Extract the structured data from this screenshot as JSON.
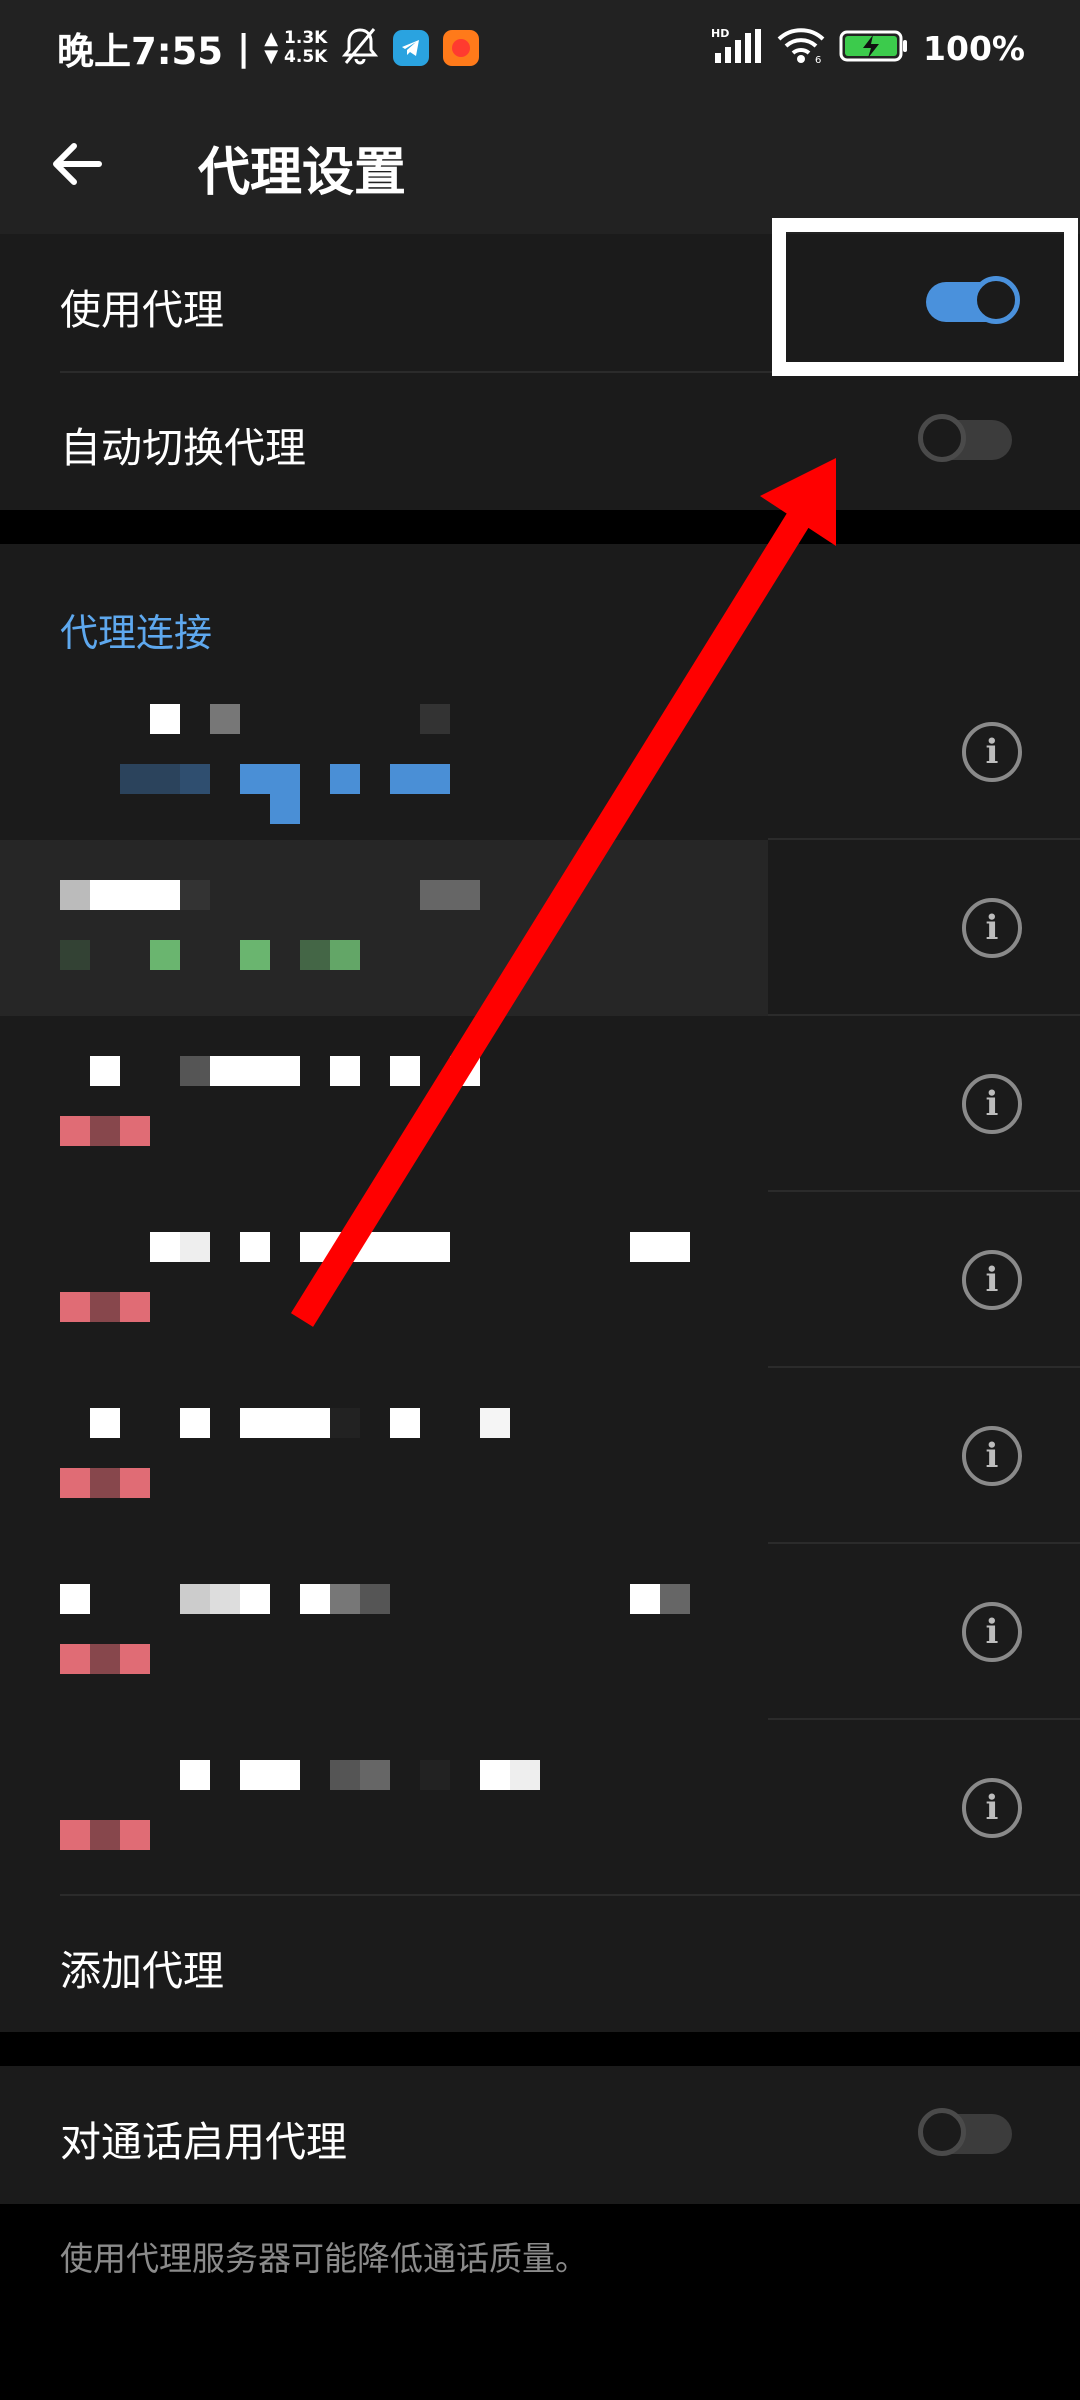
{
  "status_bar": {
    "time": "晚上7:55",
    "separator": "|",
    "speed_up": "1.3K",
    "speed_down": "4.5K",
    "network_label": "HD",
    "battery": "100%"
  },
  "toolbar": {
    "title": "代理设置"
  },
  "settings": {
    "use_proxy": {
      "label": "使用代理",
      "enabled": true
    },
    "auto_switch": {
      "label": "自动切换代理",
      "enabled": false
    }
  },
  "connections": {
    "header": "代理连接",
    "items": [
      {
        "status_color": "#4a8fd6",
        "selected": false
      },
      {
        "status_color": "#6ab56f",
        "selected": true
      },
      {
        "status_color": "#e06c75",
        "selected": false
      },
      {
        "status_color": "#e06c75",
        "selected": false
      },
      {
        "status_color": "#e06c75",
        "selected": false
      },
      {
        "status_color": "#e06c75",
        "selected": false
      },
      {
        "status_color": "#e06c75",
        "selected": false
      }
    ],
    "add_label": "添加代理"
  },
  "calls": {
    "label": "对通话启用代理",
    "enabled": false,
    "note": "使用代理服务器可能降低通话质量。"
  },
  "colors": {
    "accent": "#4a91dc",
    "annotation_arrow": "#ff0000"
  }
}
